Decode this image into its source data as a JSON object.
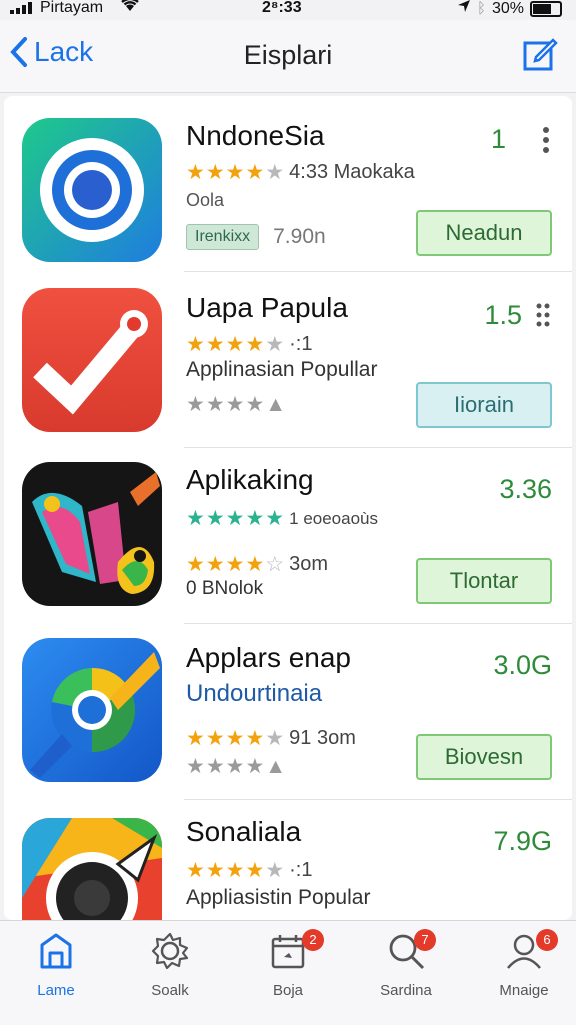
{
  "status": {
    "carrier": "Pirtayam",
    "time": "2⁸:33",
    "battery": "30%"
  },
  "nav": {
    "back_label": "Lack",
    "title": "Eisplari"
  },
  "apps": [
    {
      "name": "NndoneSia",
      "rating_text": "4:33 Maokaka",
      "sub": "Oola",
      "tag": "Irenkixx",
      "size": "7.90n",
      "price": "1",
      "action": "Neadun",
      "action_color": "green"
    },
    {
      "name": "Uapa Papula",
      "rating_text": "·:1",
      "sub": "Applinasian Popullar",
      "price": "1.5",
      "action": "Iiorain",
      "action_color": "teal"
    },
    {
      "name": "Aplikaking",
      "rating_text": "1 eoeoaoùs",
      "sub": "0 BNolok",
      "rating_text2": "3om",
      "price": "3.36",
      "action": "Tlontar",
      "action_color": "green"
    },
    {
      "name": "Applars enap",
      "sub": "Undourtinaia",
      "rating_text": "91 3om",
      "price": "3.0G",
      "action": "Biovesn",
      "action_color": "green"
    },
    {
      "name": "Sonaliala",
      "rating_text": "·:1",
      "sub": "Appliasistin Popular",
      "price": "7.9G"
    }
  ],
  "tabs": [
    {
      "label": "Lame",
      "icon": "home-icon"
    },
    {
      "label": "Soalk",
      "icon": "settings-icon"
    },
    {
      "label": "Boja",
      "icon": "calendar-icon",
      "badge": "2"
    },
    {
      "label": "Sardina",
      "icon": "search-icon",
      "badge": "7"
    },
    {
      "label": "Mnaige",
      "icon": "user-icon",
      "badge": "6"
    }
  ],
  "colors": {
    "accent": "#1a73e8",
    "price_green": "#2e8b3a",
    "star": "#f2a20c",
    "badge": "#e33a2a"
  }
}
